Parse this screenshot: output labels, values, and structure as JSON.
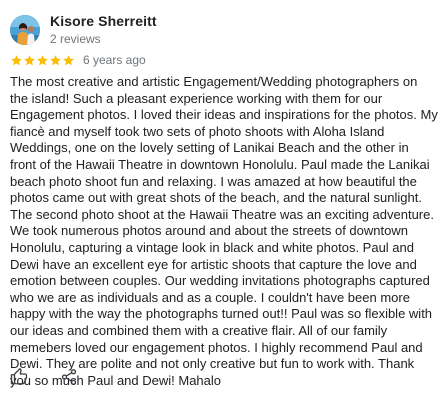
{
  "review": {
    "author": {
      "name": "Kisore Sherreitt",
      "reviews_count": "2 reviews",
      "avatar_icon": "profile-photo"
    },
    "rating": {
      "stars": 5,
      "max_stars": 5,
      "star_color": "#fbbc04"
    },
    "time": "6 years ago",
    "text": "The most creative and artistic Engagement/Wedding photographers on the island! Such a pleasant experience working with them for our Engagement photos. I loved their ideas and inspirations for the photos. My fiancè and myself took two sets of photo shoots with Aloha Island Weddings, one on the lovely setting of Lanikai Beach and the other in front of the Hawaii Theatre in downtown Honolulu. Paul made the Lanikai beach photo shoot fun and relaxing. I was amazed at how beautiful the photos came out with great shots of the beach, and the natural sunlight. The second photo shoot at the Hawaii Theatre was an exciting adventure. We took numerous photos around and about the streets of downtown Honolulu, capturing a vintage look in black and white photos. Paul and Dewi have an excellent eye for artistic shoots that capture the love and emotion between couples. Our wedding invitations photographs captured who we are as individuals and as a couple. I couldn't have been more happy with the way the photographs turned out!! Paul was so flexible with our ideas and combined them with a creative flair. All of our family memebers loved our engagement photos. I highly recommend Paul and Dewi. They are polite and not only creative but fun to work with. Thank you so much Paul and Dewi! Mahalo",
    "actions": {
      "like_icon": "thumbs-up-icon",
      "share_icon": "share-icon"
    }
  },
  "colors": {
    "text_primary": "#202124",
    "text_secondary": "#70757a",
    "icon": "#3c4043",
    "star": "#fbbc04"
  }
}
